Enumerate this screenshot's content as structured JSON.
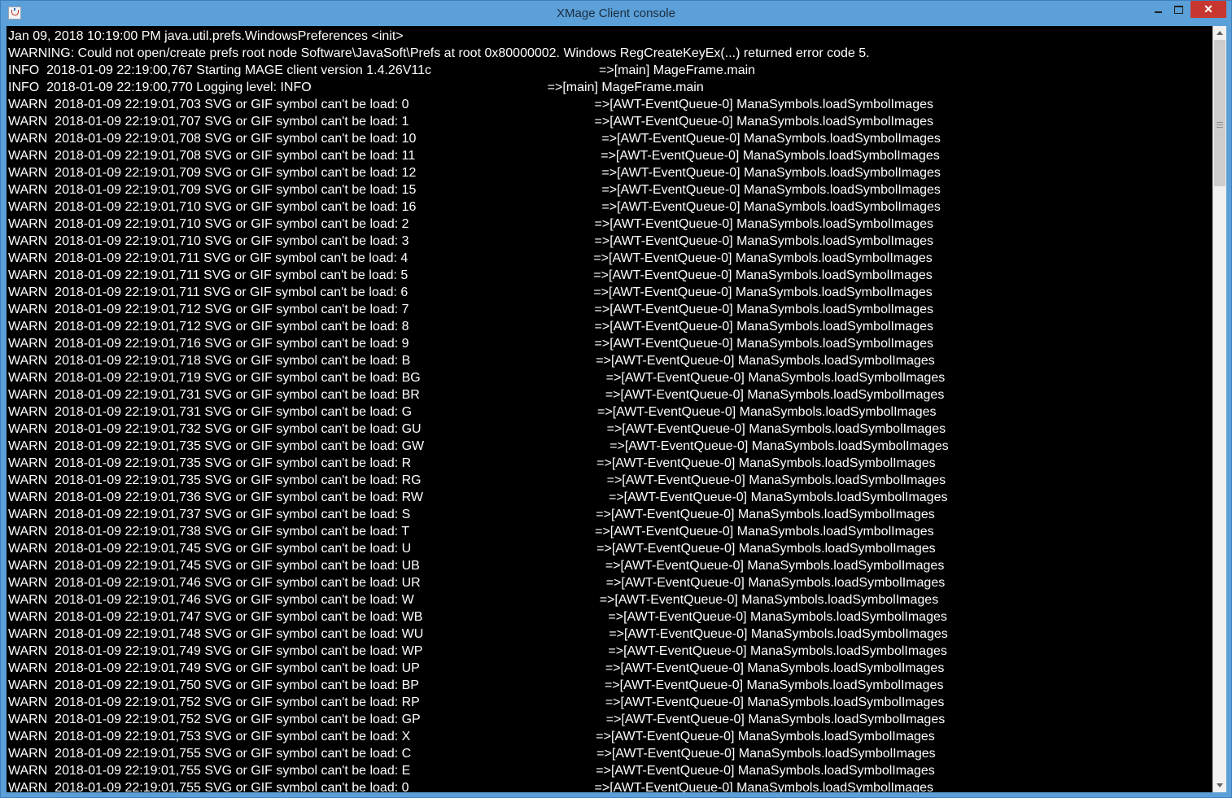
{
  "window": {
    "title": "XMage Client console",
    "close_glyph": "✕",
    "colors": {
      "titlebar": "#5ba0d9",
      "console_bg": "#000000",
      "console_text": "#ffffff",
      "close_button": "#c7372f"
    }
  },
  "console": {
    "lines": [
      {
        "text": "Jan 09, 2018 10:19:00 PM java.util.prefs.WindowsPreferences <init>",
        "source": ""
      },
      {
        "text": "WARNING: Could not open/create prefs root node Software\\JavaSoft\\Prefs at root 0x80000002. Windows RegCreateKeyEx(...) returned error code 5.",
        "source": ""
      },
      {
        "text": "INFO  2018-01-09 22:19:00,767 Starting MAGE client version 1.4.26V11c",
        "source": "=>[main] MageFrame.main"
      },
      {
        "text": "INFO  2018-01-09 22:19:00,770 Logging level: INFO",
        "source": "=>[main] MageFrame.main"
      },
      {
        "text": "WARN  2018-01-09 22:19:01,703 SVG or GIF symbol can't be load: 0",
        "source": "=>[AWT-EventQueue-0] ManaSymbols.loadSymbolImages"
      },
      {
        "text": "WARN  2018-01-09 22:19:01,707 SVG or GIF symbol can't be load: 1",
        "source": "=>[AWT-EventQueue-0] ManaSymbols.loadSymbolImages"
      },
      {
        "text": "WARN  2018-01-09 22:19:01,708 SVG or GIF symbol can't be load: 10",
        "source": "=>[AWT-EventQueue-0] ManaSymbols.loadSymbolImages"
      },
      {
        "text": "WARN  2018-01-09 22:19:01,708 SVG or GIF symbol can't be load: 11",
        "source": "=>[AWT-EventQueue-0] ManaSymbols.loadSymbolImages"
      },
      {
        "text": "WARN  2018-01-09 22:19:01,709 SVG or GIF symbol can't be load: 12",
        "source": "=>[AWT-EventQueue-0] ManaSymbols.loadSymbolImages"
      },
      {
        "text": "WARN  2018-01-09 22:19:01,709 SVG or GIF symbol can't be load: 15",
        "source": "=>[AWT-EventQueue-0] ManaSymbols.loadSymbolImages"
      },
      {
        "text": "WARN  2018-01-09 22:19:01,710 SVG or GIF symbol can't be load: 16",
        "source": "=>[AWT-EventQueue-0] ManaSymbols.loadSymbolImages"
      },
      {
        "text": "WARN  2018-01-09 22:19:01,710 SVG or GIF symbol can't be load: 2",
        "source": "=>[AWT-EventQueue-0] ManaSymbols.loadSymbolImages"
      },
      {
        "text": "WARN  2018-01-09 22:19:01,710 SVG or GIF symbol can't be load: 3",
        "source": "=>[AWT-EventQueue-0] ManaSymbols.loadSymbolImages"
      },
      {
        "text": "WARN  2018-01-09 22:19:01,711 SVG or GIF symbol can't be load: 4",
        "source": "=>[AWT-EventQueue-0] ManaSymbols.loadSymbolImages"
      },
      {
        "text": "WARN  2018-01-09 22:19:01,711 SVG or GIF symbol can't be load: 5",
        "source": "=>[AWT-EventQueue-0] ManaSymbols.loadSymbolImages"
      },
      {
        "text": "WARN  2018-01-09 22:19:01,711 SVG or GIF symbol can't be load: 6",
        "source": "=>[AWT-EventQueue-0] ManaSymbols.loadSymbolImages"
      },
      {
        "text": "WARN  2018-01-09 22:19:01,712 SVG or GIF symbol can't be load: 7",
        "source": "=>[AWT-EventQueue-0] ManaSymbols.loadSymbolImages"
      },
      {
        "text": "WARN  2018-01-09 22:19:01,712 SVG or GIF symbol can't be load: 8",
        "source": "=>[AWT-EventQueue-0] ManaSymbols.loadSymbolImages"
      },
      {
        "text": "WARN  2018-01-09 22:19:01,716 SVG or GIF symbol can't be load: 9",
        "source": "=>[AWT-EventQueue-0] ManaSymbols.loadSymbolImages"
      },
      {
        "text": "WARN  2018-01-09 22:19:01,718 SVG or GIF symbol can't be load: B",
        "source": "=>[AWT-EventQueue-0] ManaSymbols.loadSymbolImages"
      },
      {
        "text": "WARN  2018-01-09 22:19:01,719 SVG or GIF symbol can't be load: BG",
        "source": "=>[AWT-EventQueue-0] ManaSymbols.loadSymbolImages"
      },
      {
        "text": "WARN  2018-01-09 22:19:01,731 SVG or GIF symbol can't be load: BR",
        "source": "=>[AWT-EventQueue-0] ManaSymbols.loadSymbolImages"
      },
      {
        "text": "WARN  2018-01-09 22:19:01,731 SVG or GIF symbol can't be load: G",
        "source": "=>[AWT-EventQueue-0] ManaSymbols.loadSymbolImages"
      },
      {
        "text": "WARN  2018-01-09 22:19:01,732 SVG or GIF symbol can't be load: GU",
        "source": "=>[AWT-EventQueue-0] ManaSymbols.loadSymbolImages"
      },
      {
        "text": "WARN  2018-01-09 22:19:01,735 SVG or GIF symbol can't be load: GW",
        "source": "=>[AWT-EventQueue-0] ManaSymbols.loadSymbolImages"
      },
      {
        "text": "WARN  2018-01-09 22:19:01,735 SVG or GIF symbol can't be load: R",
        "source": "=>[AWT-EventQueue-0] ManaSymbols.loadSymbolImages"
      },
      {
        "text": "WARN  2018-01-09 22:19:01,735 SVG or GIF symbol can't be load: RG",
        "source": "=>[AWT-EventQueue-0] ManaSymbols.loadSymbolImages"
      },
      {
        "text": "WARN  2018-01-09 22:19:01,736 SVG or GIF symbol can't be load: RW",
        "source": "=>[AWT-EventQueue-0] ManaSymbols.loadSymbolImages"
      },
      {
        "text": "WARN  2018-01-09 22:19:01,737 SVG or GIF symbol can't be load: S",
        "source": "=>[AWT-EventQueue-0] ManaSymbols.loadSymbolImages"
      },
      {
        "text": "WARN  2018-01-09 22:19:01,738 SVG or GIF symbol can't be load: T",
        "source": "=>[AWT-EventQueue-0] ManaSymbols.loadSymbolImages"
      },
      {
        "text": "WARN  2018-01-09 22:19:01,745 SVG or GIF symbol can't be load: U",
        "source": "=>[AWT-EventQueue-0] ManaSymbols.loadSymbolImages"
      },
      {
        "text": "WARN  2018-01-09 22:19:01,745 SVG or GIF symbol can't be load: UB",
        "source": "=>[AWT-EventQueue-0] ManaSymbols.loadSymbolImages"
      },
      {
        "text": "WARN  2018-01-09 22:19:01,746 SVG or GIF symbol can't be load: UR",
        "source": "=>[AWT-EventQueue-0] ManaSymbols.loadSymbolImages"
      },
      {
        "text": "WARN  2018-01-09 22:19:01,746 SVG or GIF symbol can't be load: W",
        "source": "=>[AWT-EventQueue-0] ManaSymbols.loadSymbolImages"
      },
      {
        "text": "WARN  2018-01-09 22:19:01,747 SVG or GIF symbol can't be load: WB",
        "source": "=>[AWT-EventQueue-0] ManaSymbols.loadSymbolImages"
      },
      {
        "text": "WARN  2018-01-09 22:19:01,748 SVG or GIF symbol can't be load: WU",
        "source": "=>[AWT-EventQueue-0] ManaSymbols.loadSymbolImages"
      },
      {
        "text": "WARN  2018-01-09 22:19:01,749 SVG or GIF symbol can't be load: WP",
        "source": "=>[AWT-EventQueue-0] ManaSymbols.loadSymbolImages"
      },
      {
        "text": "WARN  2018-01-09 22:19:01,749 SVG or GIF symbol can't be load: UP",
        "source": "=>[AWT-EventQueue-0] ManaSymbols.loadSymbolImages"
      },
      {
        "text": "WARN  2018-01-09 22:19:01,750 SVG or GIF symbol can't be load: BP",
        "source": "=>[AWT-EventQueue-0] ManaSymbols.loadSymbolImages"
      },
      {
        "text": "WARN  2018-01-09 22:19:01,752 SVG or GIF symbol can't be load: RP",
        "source": "=>[AWT-EventQueue-0] ManaSymbols.loadSymbolImages"
      },
      {
        "text": "WARN  2018-01-09 22:19:01,752 SVG or GIF symbol can't be load: GP",
        "source": "=>[AWT-EventQueue-0] ManaSymbols.loadSymbolImages"
      },
      {
        "text": "WARN  2018-01-09 22:19:01,753 SVG or GIF symbol can't be load: X",
        "source": "=>[AWT-EventQueue-0] ManaSymbols.loadSymbolImages"
      },
      {
        "text": "WARN  2018-01-09 22:19:01,755 SVG or GIF symbol can't be load: C",
        "source": "=>[AWT-EventQueue-0] ManaSymbols.loadSymbolImages"
      },
      {
        "text": "WARN  2018-01-09 22:19:01,755 SVG or GIF symbol can't be load: E",
        "source": "=>[AWT-EventQueue-0] ManaSymbols.loadSymbolImages"
      },
      {
        "text": "WARN  2018-01-09 22:19:01,755 SVG or GIF symbol can't be load: 0",
        "source": "=>[AWT-EventQueue-0] ManaSymbols.loadSymbolImages"
      }
    ]
  }
}
